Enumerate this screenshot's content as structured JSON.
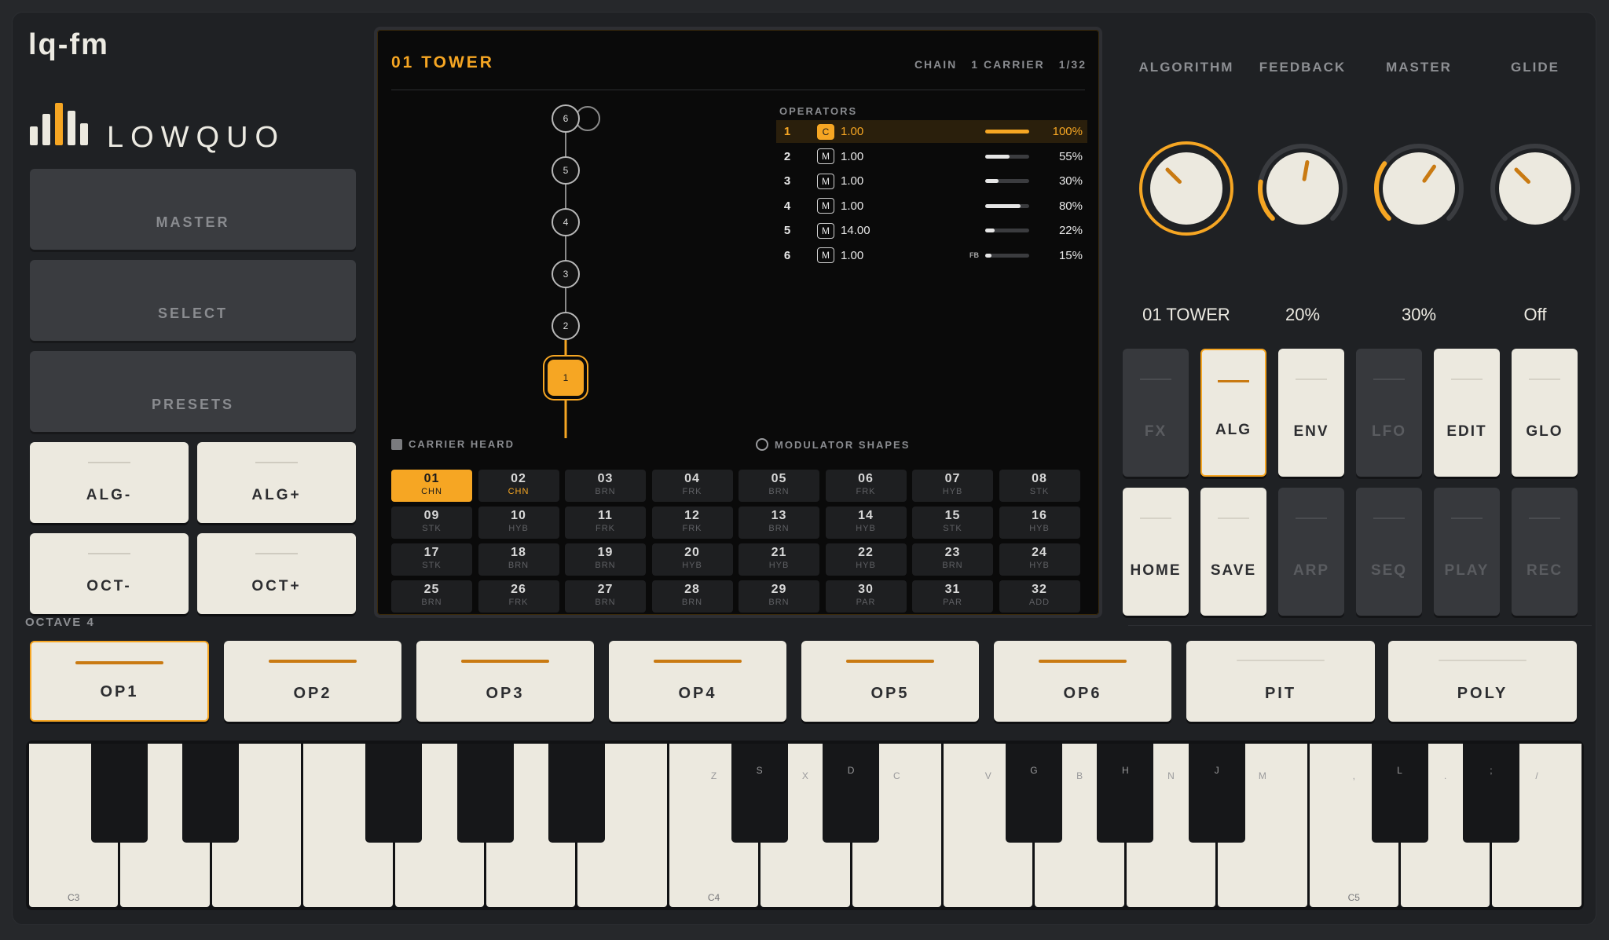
{
  "app": {
    "title": "lq-fm",
    "brand": "LOWQUO"
  },
  "left": {
    "master": "MASTER",
    "select": "SELECT",
    "presets": "PRESETS",
    "alg_minus": "ALG-",
    "alg_plus": "ALG+",
    "oct_minus": "OCT-",
    "oct_plus": "OCT+",
    "octave_label": "OCTAVE 4"
  },
  "screen": {
    "title": "01 TOWER",
    "chain": "CHAIN",
    "carrier": "1 CARRIER",
    "page": "1/32",
    "operators_heading": "OPERATORS",
    "nodes": [
      "6",
      "5",
      "4",
      "3",
      "2",
      "1"
    ],
    "operators": [
      {
        "num": "1",
        "type": "C",
        "ratio": "1.00",
        "level": 1.0,
        "pct": "100%",
        "selected": true,
        "fb": ""
      },
      {
        "num": "2",
        "type": "M",
        "ratio": "1.00",
        "level": 0.55,
        "pct": "55%",
        "selected": false,
        "fb": ""
      },
      {
        "num": "3",
        "type": "M",
        "ratio": "1.00",
        "level": 0.3,
        "pct": "30%",
        "selected": false,
        "fb": ""
      },
      {
        "num": "4",
        "type": "M",
        "ratio": "1.00",
        "level": 0.8,
        "pct": "80%",
        "selected": false,
        "fb": ""
      },
      {
        "num": "5",
        "type": "M",
        "ratio": "14.00",
        "level": 0.22,
        "pct": "22%",
        "selected": false,
        "fb": ""
      },
      {
        "num": "6",
        "type": "M",
        "ratio": "1.00",
        "level": 0.15,
        "pct": "15%",
        "selected": false,
        "fb": "FB"
      }
    ],
    "legend_carrier": "CARRIER  HEARD",
    "legend_modulator": "MODULATOR SHAPES",
    "presets": [
      {
        "n": "01",
        "t": "CHN"
      },
      {
        "n": "02",
        "t": "CHN"
      },
      {
        "n": "03",
        "t": "BRN"
      },
      {
        "n": "04",
        "t": "FRK"
      },
      {
        "n": "05",
        "t": "BRN"
      },
      {
        "n": "06",
        "t": "FRK"
      },
      {
        "n": "07",
        "t": "HYB"
      },
      {
        "n": "08",
        "t": "STK"
      },
      {
        "n": "09",
        "t": "STK"
      },
      {
        "n": "10",
        "t": "HYB"
      },
      {
        "n": "11",
        "t": "FRK"
      },
      {
        "n": "12",
        "t": "FRK"
      },
      {
        "n": "13",
        "t": "BRN"
      },
      {
        "n": "14",
        "t": "HYB"
      },
      {
        "n": "15",
        "t": "STK"
      },
      {
        "n": "16",
        "t": "HYB"
      },
      {
        "n": "17",
        "t": "STK"
      },
      {
        "n": "18",
        "t": "BRN"
      },
      {
        "n": "19",
        "t": "BRN"
      },
      {
        "n": "20",
        "t": "HYB"
      },
      {
        "n": "21",
        "t": "HYB"
      },
      {
        "n": "22",
        "t": "HYB"
      },
      {
        "n": "23",
        "t": "BRN"
      },
      {
        "n": "24",
        "t": "HYB"
      },
      {
        "n": "25",
        "t": "BRN"
      },
      {
        "n": "26",
        "t": "FRK"
      },
      {
        "n": "27",
        "t": "BRN"
      },
      {
        "n": "28",
        "t": "BRN"
      },
      {
        "n": "29",
        "t": "BRN"
      },
      {
        "n": "30",
        "t": "PAR"
      },
      {
        "n": "31",
        "t": "PAR"
      },
      {
        "n": "32",
        "t": "ADD"
      }
    ]
  },
  "knobs": [
    {
      "label": "ALGORITHM",
      "value": "01 TOWER",
      "level": 0.0,
      "pointer": -45,
      "active": true
    },
    {
      "label": "FEEDBACK",
      "value": "20%",
      "level": 0.2,
      "pointer": 10,
      "active": false
    },
    {
      "label": "MASTER",
      "value": "30%",
      "level": 0.3,
      "pointer": 35,
      "active": false
    },
    {
      "label": "GLIDE",
      "value": "Off",
      "level": 0.0,
      "pointer": -45,
      "active": false
    }
  ],
  "grid_buttons": [
    {
      "label": "FX",
      "state": "off"
    },
    {
      "label": "ALG",
      "state": "active"
    },
    {
      "label": "ENV",
      "state": "on"
    },
    {
      "label": "LFO",
      "state": "off"
    },
    {
      "label": "EDIT",
      "state": "on"
    },
    {
      "label": "GLO",
      "state": "on"
    },
    {
      "label": "HOME",
      "state": "on"
    },
    {
      "label": "SAVE",
      "state": "on"
    },
    {
      "label": "ARP",
      "state": "off"
    },
    {
      "label": "SEQ",
      "state": "off"
    },
    {
      "label": "PLAY",
      "state": "off"
    },
    {
      "label": "REC",
      "state": "off"
    }
  ],
  "op_buttons": [
    {
      "label": "OP1",
      "active": true,
      "accent": true
    },
    {
      "label": "OP2",
      "active": false,
      "accent": true
    },
    {
      "label": "OP3",
      "active": false,
      "accent": true
    },
    {
      "label": "OP4",
      "active": false,
      "accent": true
    },
    {
      "label": "OP5",
      "active": false,
      "accent": true
    },
    {
      "label": "OP6",
      "active": false,
      "accent": true
    },
    {
      "label": "PIT",
      "active": false,
      "accent": false
    },
    {
      "label": "POLY",
      "active": false,
      "accent": false
    }
  ],
  "keyboard": {
    "white_keys": [
      {
        "note": "C3",
        "key": ""
      },
      {
        "note": "",
        "key": ""
      },
      {
        "note": "",
        "key": ""
      },
      {
        "note": "",
        "key": ""
      },
      {
        "note": "",
        "key": ""
      },
      {
        "note": "",
        "key": ""
      },
      {
        "note": "",
        "key": ""
      },
      {
        "note": "C4",
        "key": "Z"
      },
      {
        "note": "",
        "key": "X"
      },
      {
        "note": "",
        "key": "C"
      },
      {
        "note": "",
        "key": "V"
      },
      {
        "note": "",
        "key": "B"
      },
      {
        "note": "",
        "key": "N"
      },
      {
        "note": "",
        "key": "M"
      },
      {
        "note": "C5",
        "key": ","
      },
      {
        "note": "",
        "key": "."
      },
      {
        "note": "",
        "key": "/"
      }
    ],
    "black_keys": [
      {
        "after": 0,
        "key": ""
      },
      {
        "after": 1,
        "key": ""
      },
      {
        "after": 3,
        "key": ""
      },
      {
        "after": 4,
        "key": ""
      },
      {
        "after": 5,
        "key": ""
      },
      {
        "after": 7,
        "key": "S"
      },
      {
        "after": 8,
        "key": "D"
      },
      {
        "after": 10,
        "key": "G"
      },
      {
        "after": 11,
        "key": "H"
      },
      {
        "after": 12,
        "key": "J"
      },
      {
        "after": 14,
        "key": "L"
      },
      {
        "after": 15,
        "key": ";"
      }
    ]
  },
  "colors": {
    "accent": "#f6a623",
    "cream": "#ece9df",
    "panel": "#1f2124",
    "screen": "#0a0a0a"
  }
}
